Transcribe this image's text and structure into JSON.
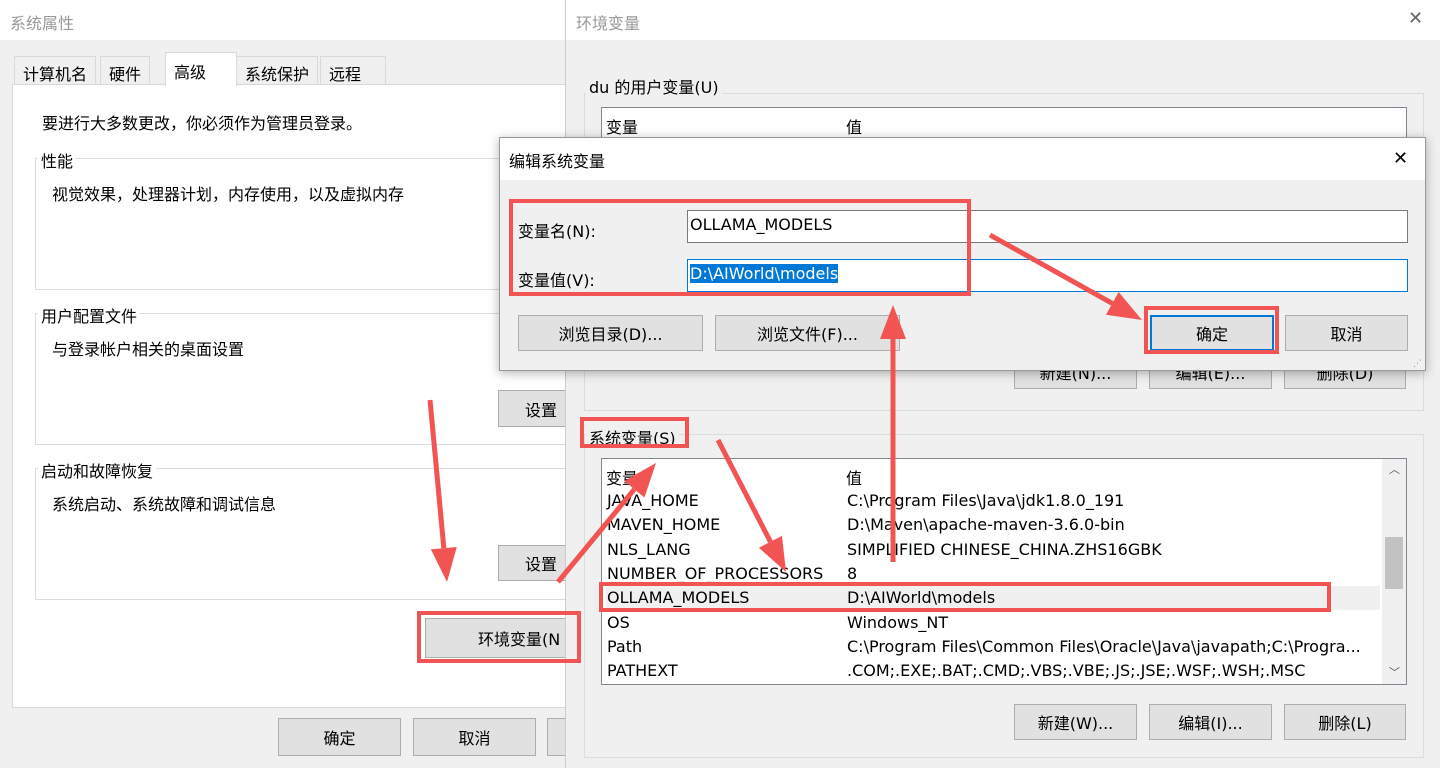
{
  "sys_props": {
    "title": "系统属性",
    "tabs": [
      "计算机名",
      "硬件",
      "高级",
      "系统保护",
      "远程"
    ],
    "active_tab": "高级",
    "admin_note": "要进行大多数更改，你必须作为管理员登录。",
    "performance": {
      "label": "性能",
      "desc": "视觉效果，处理器计划，内存使用，以及虚拟内存",
      "button": "设置"
    },
    "profiles": {
      "label": "用户配置文件",
      "desc": "与登录帐户相关的桌面设置",
      "button": "设置"
    },
    "startup": {
      "label": "启动和故障恢复",
      "desc": "系统启动、系统故障和调试信息",
      "button": "设置"
    },
    "env_button": "环境变量(N",
    "ok": "确定",
    "cancel": "取消"
  },
  "env_vars": {
    "title": "环境变量",
    "close": "✕",
    "user_group": "du 的用户变量(U)",
    "col_var": "变量",
    "col_val": "值",
    "user_buttons": [
      "新建(N)...",
      "编辑(E)...",
      "删除(D)"
    ],
    "system_group": "系统变量(S)",
    "system_rows": [
      {
        "name": "JAVA_HOME",
        "value": "C:\\Program Files\\Java\\jdk1.8.0_191"
      },
      {
        "name": "MAVEN_HOME",
        "value": "D:\\Maven\\apache-maven-3.6.0-bin"
      },
      {
        "name": "NLS_LANG",
        "value": "SIMPLIFIED CHINESE_CHINA.ZHS16GBK"
      },
      {
        "name": "NUMBER_OF_PROCESSORS",
        "value": "8"
      },
      {
        "name": "OLLAMA_MODELS",
        "value": "D:\\AIWorld\\models"
      },
      {
        "name": "OS",
        "value": "Windows_NT"
      },
      {
        "name": "Path",
        "value": "C:\\Program Files\\Common Files\\Oracle\\Java\\javapath;C:\\Progra..."
      },
      {
        "name": "PATHEXT",
        "value": ".COM;.EXE;.BAT;.CMD;.VBS;.VBE;.JS;.JSE;.WSF;.WSH;.MSC"
      }
    ],
    "selected_row": "OLLAMA_MODELS",
    "system_buttons": [
      "新建(W)...",
      "编辑(I)...",
      "删除(L)"
    ]
  },
  "edit_dialog": {
    "title": "编辑系统变量",
    "close": "✕",
    "name_label": "变量名(N):",
    "name_value": "OLLAMA_MODELS",
    "value_label": "变量值(V):",
    "value_value": "D:\\AIWorld\\models",
    "browse_dir": "浏览目录(D)...",
    "browse_file": "浏览文件(F)...",
    "ok": "确定",
    "cancel": "取消"
  },
  "annotation_color": "#f25353"
}
